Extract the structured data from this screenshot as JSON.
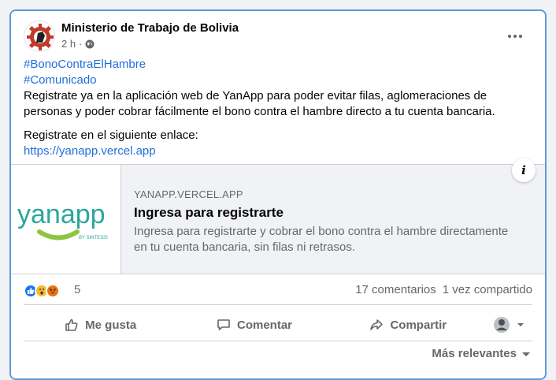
{
  "post": {
    "page_name": "Ministerio de Trabajo de Bolivia",
    "time": "2 h",
    "dot": "·",
    "privacy_icon": "globe-icon",
    "more_icon": "more-options-icon",
    "hashtags": [
      "#BonoContraElHambre",
      "#Comunicado"
    ],
    "body_text": "Registrate ya en la aplicación web de YanApp para poder evitar filas, aglomeraciones de personas y poder cobrar fácilmente el bono contra el hambre directo a tu cuenta bancaria.",
    "link_intro": "Registrate en el siguiente enlace:",
    "link_text": "https://yanapp.vercel.app",
    "link_color": "#216fdb"
  },
  "link_preview": {
    "logo_text": "yanapp",
    "logo_sub": "BY SINTESIS",
    "domain": "YANAPP.VERCEL.APP",
    "title": "Ingresa para registrarte",
    "description": "Ingresa para registrarte y cobrar el bono contra el hambre directamente en tu cuenta bancaria, sin filas ni retrasos.",
    "info_label": "i"
  },
  "stats": {
    "reactions": [
      "like",
      "wow",
      "angry"
    ],
    "reaction_count": "5",
    "comments": "17 comentarios",
    "shares": "1 vez compartido"
  },
  "actions": {
    "like": "Me gusta",
    "comment": "Comentar",
    "share": "Compartir"
  },
  "comments_sort": "Más relevantes",
  "colors": {
    "accent": "#216fdb",
    "like_blue": "#1877f2",
    "logo_teal": "#2aa79b",
    "logo_green": "#8cc63f"
  }
}
